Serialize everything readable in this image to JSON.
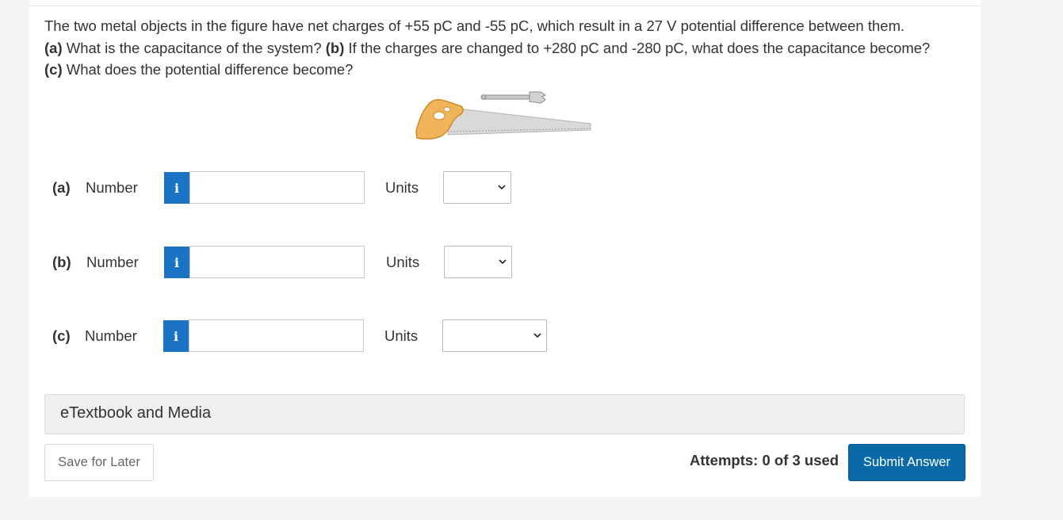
{
  "question": {
    "line1": "The two metal objects in the figure have net charges of +55 pC and -55 pC, which result in a 27 V potential difference between them.",
    "a_tag": "(a)",
    "a_text": " What is the capacitance of the system? ",
    "b_tag": "(b)",
    "b_text": " If the charges are changed to +280 pC and -280 pC, what does the capacitance become?",
    "c_tag": "(c)",
    "c_text": " What does the potential difference become?"
  },
  "figure": {
    "icon": "saw-and-wrench-icon"
  },
  "parts": [
    {
      "label": "(a)",
      "number_label": "Number",
      "info": "i",
      "value": "",
      "units_label": "Units",
      "units_value": ""
    },
    {
      "label": "(b)",
      "number_label": "Number",
      "info": "i",
      "value": "",
      "units_label": "Units",
      "units_value": ""
    },
    {
      "label": "(c)",
      "number_label": "Number",
      "info": "i",
      "value": "",
      "units_label": "Units",
      "units_value": ""
    }
  ],
  "etextbook": {
    "label": "eTextbook and Media"
  },
  "footer": {
    "save_label": "Save for Later",
    "attempts": "Attempts: 0 of 3 used",
    "submit_label": "Submit Answer"
  },
  "colors": {
    "accent": "#1a73c5",
    "submit": "#0a6aa8",
    "page_bg": "#f4f4f4"
  }
}
